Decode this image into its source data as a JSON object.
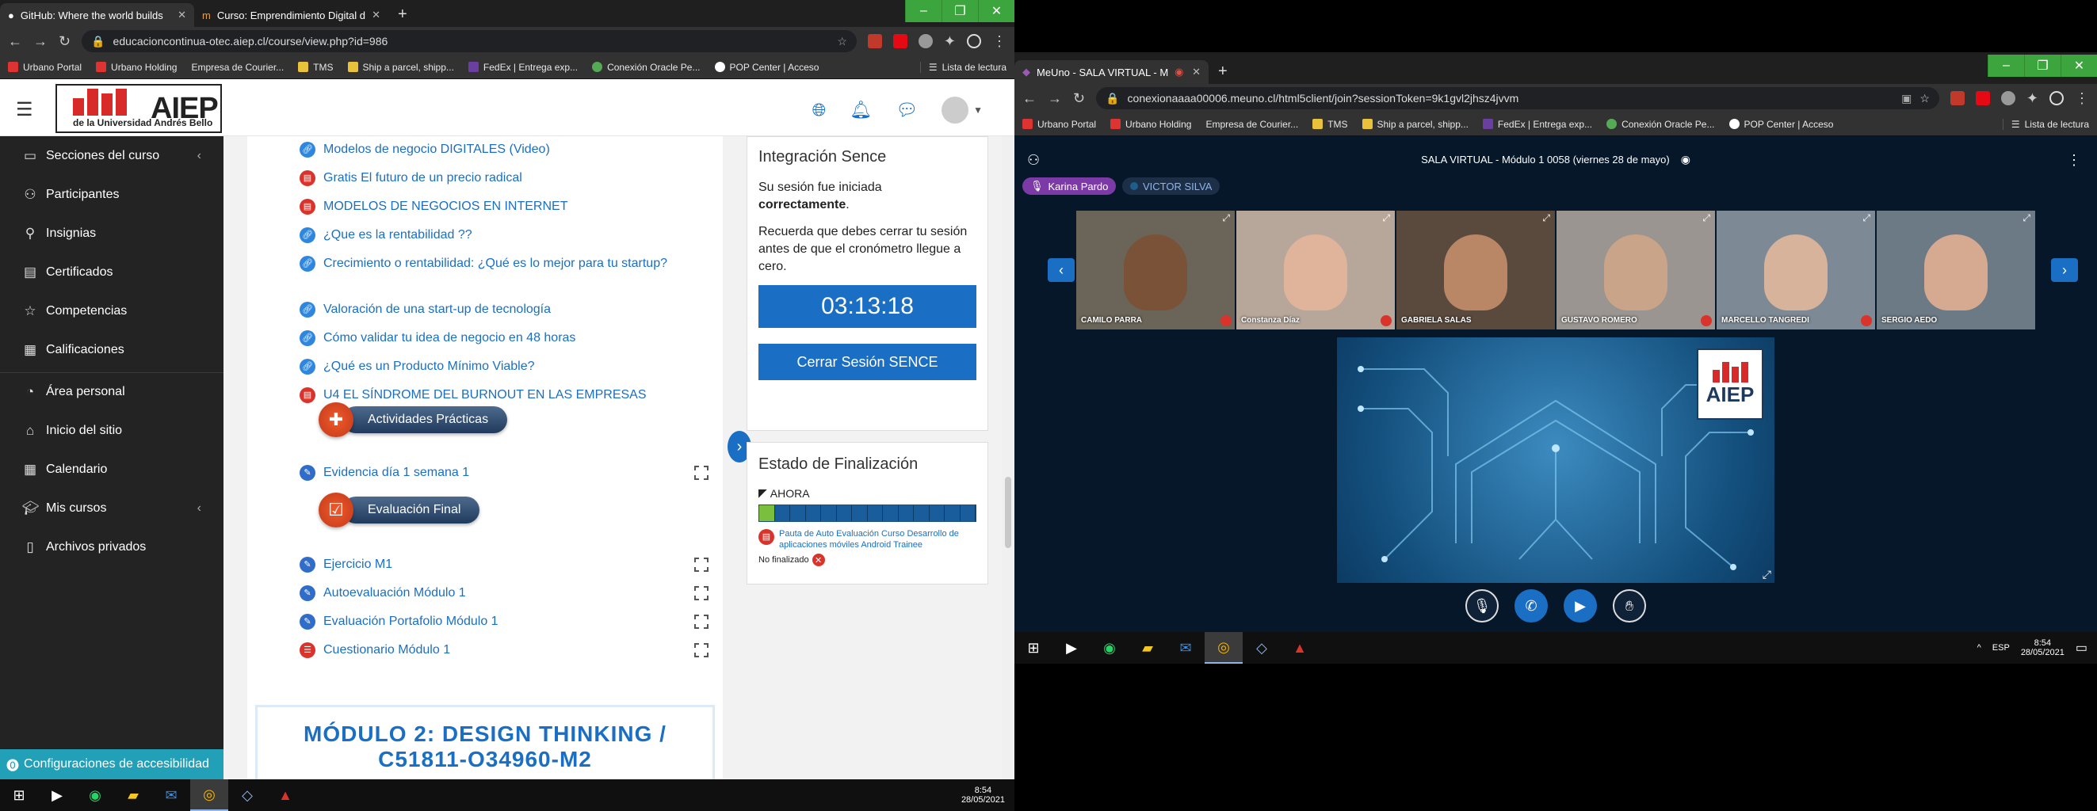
{
  "left_browser": {
    "tabs": [
      {
        "title": "GitHub: Where the world builds",
        "active": true
      },
      {
        "title": "Curso: Emprendimiento Digital d",
        "active": false
      }
    ],
    "url": "educacioncontinua-otec.aiep.cl/course/view.php?id=986",
    "bookmarks": [
      "Urbano Portal",
      "Urbano Holding",
      "Empresa de Courier...",
      "TMS",
      "Ship a parcel, shipp...",
      "FedEx | Entrega exp...",
      "Conexión Oracle Pe...",
      "POP Center | Acceso"
    ],
    "reading_list": "Lista de lectura"
  },
  "moodle": {
    "logo_word": "AIEP",
    "logo_sub": "de la Universidad Andrés Bello",
    "nav": [
      {
        "label": "Secciones del curso",
        "icon": "folder-icon",
        "chevron": true
      },
      {
        "label": "Participantes",
        "icon": "users-icon"
      },
      {
        "label": "Insignias",
        "icon": "badge-icon"
      },
      {
        "label": "Certificados",
        "icon": "certificate-icon"
      },
      {
        "label": "Competencias",
        "icon": "star-icon"
      },
      {
        "label": "Calificaciones",
        "icon": "grades-icon"
      },
      {
        "label": "Área personal",
        "icon": "dashboard-icon"
      },
      {
        "label": "Inicio del sitio",
        "icon": "home-icon"
      },
      {
        "label": "Calendario",
        "icon": "calendar-icon"
      },
      {
        "label": "Mis cursos",
        "icon": "courses-icon",
        "chevron": true
      },
      {
        "label": "Archivos privados",
        "icon": "file-icon"
      }
    ],
    "accessibility": "Configuraciones de accesibilidad",
    "activities": [
      {
        "label": "Modelos de negocio DIGITALES (Video)",
        "type": "link"
      },
      {
        "label": "Gratis El futuro de un precio radical",
        "type": "pdf"
      },
      {
        "label": "MODELOS DE NEGOCIOS EN INTERNET",
        "type": "pdf"
      },
      {
        "label": "¿Que es la rentabilidad ??",
        "type": "link"
      },
      {
        "label": "Crecimiento o rentabilidad: ¿Qué es lo mejor para tu startup?",
        "type": "link"
      },
      {
        "label": "Valoración de una start-up de tecnología",
        "type": "link"
      },
      {
        "label": "Cómo validar tu idea de negocio en 48 horas",
        "type": "link"
      },
      {
        "label": "¿Qué es un Producto Mínimo Viable?",
        "type": "link"
      },
      {
        "label": "U4 EL SÍNDROME DEL BURNOUT EN LAS EMPRESAS",
        "type": "pdf"
      }
    ],
    "section_practicas": "Actividades Prácticas",
    "practicas": [
      {
        "label": "Evidencia día 1 semana 1"
      }
    ],
    "section_final": "Evaluación Final",
    "final_items": [
      {
        "label": "Ejercicio M1",
        "type": "quiz"
      },
      {
        "label": "Autoevaluación Módulo 1",
        "type": "quiz"
      },
      {
        "label": "Evaluación Portafolio Módulo 1",
        "type": "quiz"
      },
      {
        "label": "Cuestionario Módulo 1",
        "type": "form"
      }
    ],
    "module2_line1": "MÓDULO 2: DESIGN THINKING /",
    "module2_line2": "C51811-O34960-M2",
    "sence": {
      "title": "Integración Sence",
      "line1": "Su sesión fue iniciada",
      "line1b": "correctamente",
      "line2": "Recuerda que debes cerrar tu sesión antes de que el cronómetro llegue a cero.",
      "timer": "03:13:18",
      "close_btn": "Cerrar Sesión SENCE"
    },
    "finalizacion": {
      "title": "Estado de Finalización",
      "now": "AHORA",
      "progress_done": 1,
      "progress_total": 14,
      "item": "Pauta de Auto Evaluación Curso Desarrollo de aplicaciones móviles Android Trainee",
      "status": "No finalizado"
    }
  },
  "left_taskbar": {
    "time": "8:54",
    "date": "28/05/2021"
  },
  "right_browser": {
    "tab": "MeUno - SALA VIRTUAL - M",
    "url": "conexionaaaa00006.meuno.cl/html5client/join?sessionToken=9k1gvl2jhsz4jvvm",
    "bookmarks": [
      "Urbano Portal",
      "Urbano Holding",
      "Empresa de Courier...",
      "TMS",
      "Ship a parcel, shipp...",
      "FedEx | Entrega exp...",
      "Conexión Oracle Pe...",
      "POP Center | Acceso"
    ],
    "reading_list": "Lista de lectura"
  },
  "meeting": {
    "title": "SALA VIRTUAL - Módulo 1 0058 (viernes 28 de mayo)",
    "presenter": "Karina Pardo",
    "talker": "VICTOR SILVA",
    "participants": [
      "CAMILO PARRA",
      "Constanza Díaz",
      "GABRIELA SALAS",
      "GUSTAVO ROMERO",
      "MARCELLO TANGREDI",
      "SERGIO AEDO"
    ],
    "slide_logo": "AIEP"
  },
  "right_taskbar": {
    "lang": "ESP",
    "time": "8:54",
    "date": "28/05/2021"
  }
}
